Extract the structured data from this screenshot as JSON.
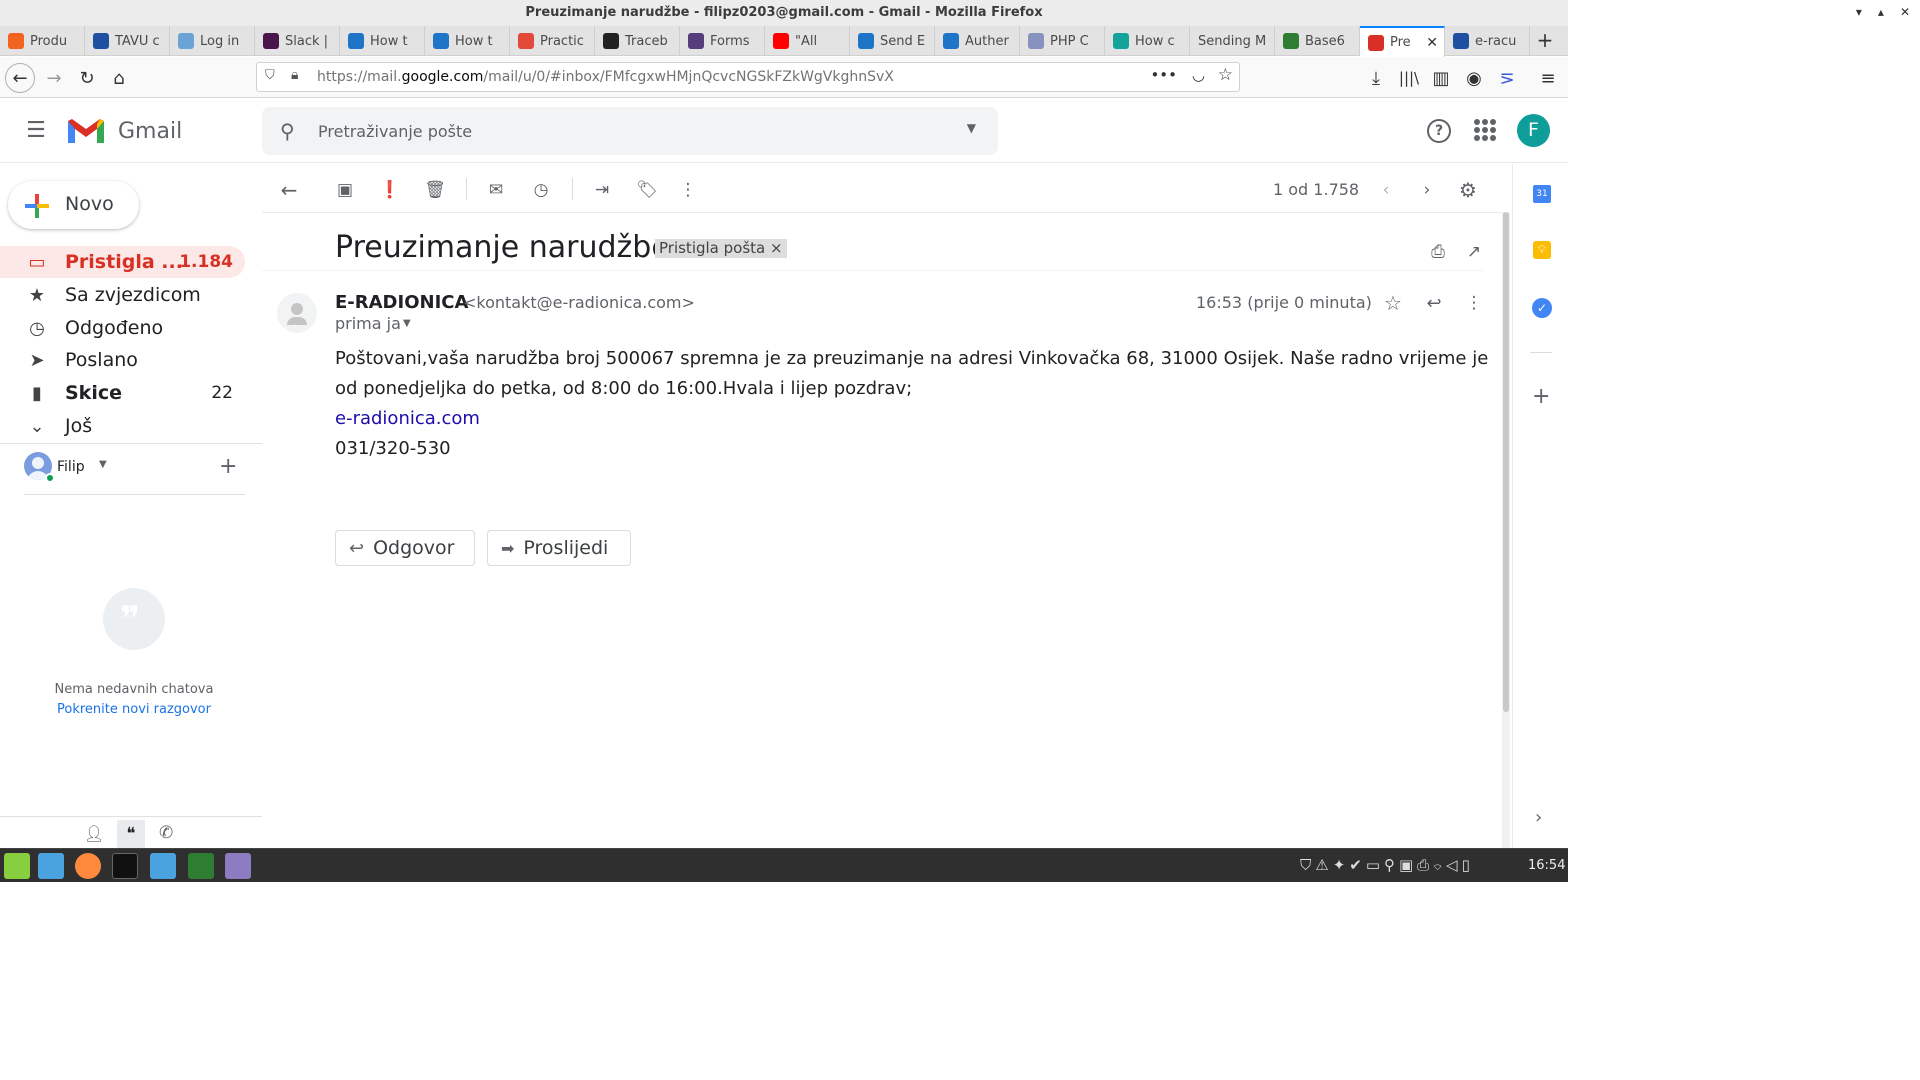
{
  "window": {
    "title": "Preuzimanje narudžbe - filipz0203@gmail.com - Gmail - Mozilla Firefox"
  },
  "tabs": [
    {
      "label": "Produ",
      "icon": "magento-icon",
      "color": "#f26322"
    },
    {
      "label": "TAVU c",
      "icon": "e-icon",
      "color": "#1e4fa0"
    },
    {
      "label": "Log in",
      "icon": "cloud-icon",
      "color": "#6ba3d6"
    },
    {
      "label": "Slack |",
      "icon": "slack-icon",
      "color": "#4a154b"
    },
    {
      "label": "How t",
      "icon": "stackexchange-icon",
      "color": "#1e74c6"
    },
    {
      "label": "How t",
      "icon": "stackexchange-icon",
      "color": "#1e74c6"
    },
    {
      "label": "Practic",
      "icon": "u-icon",
      "color": "#e2493b"
    },
    {
      "label": "Traceb",
      "icon": "bug-icon",
      "color": "#222222"
    },
    {
      "label": "Forms",
      "icon": "bootstrap-icon",
      "color": "#563d7c"
    },
    {
      "label": "\"All",
      "icon": "youtube-icon",
      "color": "#ff0000"
    },
    {
      "label": "Send E",
      "icon": "stackexchange-icon",
      "color": "#1e74c6"
    },
    {
      "label": "Auther",
      "icon": "stackexchange-icon",
      "color": "#1e74c6"
    },
    {
      "label": "PHP C",
      "icon": "php-icon",
      "color": "#8892bf"
    },
    {
      "label": "How c",
      "icon": "r-icon",
      "color": "#14a39a"
    },
    {
      "label": "Sending M",
      "icon": "",
      "color": ""
    },
    {
      "label": "Base6",
      "icon": "b64-icon",
      "color": "#2e7d32"
    },
    {
      "label": "Pre",
      "icon": "gmail-icon",
      "color": "#d93025"
    },
    {
      "label": "e-racu",
      "icon": "e-icon",
      "color": "#1e4fa0"
    }
  ],
  "urlbar": {
    "host_prefix": "https://mail.",
    "host": "google.com",
    "path": "/mail/u/0/#inbox/FMfcgxwHMjnQcvcNGSkFZkWgVkghnSvX"
  },
  "gmail": {
    "logo_text": "Gmail",
    "search_placeholder": "Pretraživanje pošte",
    "avatar_letter": "F",
    "compose_label": "Novo",
    "nav": [
      {
        "label": "Pristigla ...",
        "count": "1.184",
        "icon": "inbox-icon"
      },
      {
        "label": "Sa zvjezdicom",
        "count": "",
        "icon": "star-icon"
      },
      {
        "label": "Odgođeno",
        "count": "",
        "icon": "clock-icon"
      },
      {
        "label": "Poslano",
        "count": "",
        "icon": "send-icon"
      },
      {
        "label": "Skice",
        "count": "22",
        "icon": "draft-icon"
      },
      {
        "label": "Još",
        "count": "",
        "icon": "chevron-down-icon"
      }
    ],
    "hangouts_user": "Filip",
    "no_chats": "Nema nedavnih chatova",
    "start_chat": "Pokrenite novi razgovor",
    "pagination": "1 od 1.758",
    "subject": "Preuzimanje narudžbe",
    "label_chip": "Pristigla pošta",
    "sender_name": "E-RADIONICA",
    "sender_email": "<kontakt@e-radionica.com>",
    "recipient": "prima ja",
    "time": "16:53 (prije 0 minuta)",
    "body_line1": "Poštovani,vaša narudžba broj 500067 spremna je za preuzimanje na adresi Vinkovačka 68, 31000 Osijek. Naše radno vrijeme je",
    "body_line2": "od ponedjeljka do petka, od 8:00 do 16:00.Hvala i lijep pozdrav;",
    "body_link": "e-radionica.com",
    "body_phone": "031/320-530",
    "reply_label": "Odgovor",
    "forward_label": "Proslijedi"
  },
  "taskbar": {
    "clock": "16:54"
  }
}
